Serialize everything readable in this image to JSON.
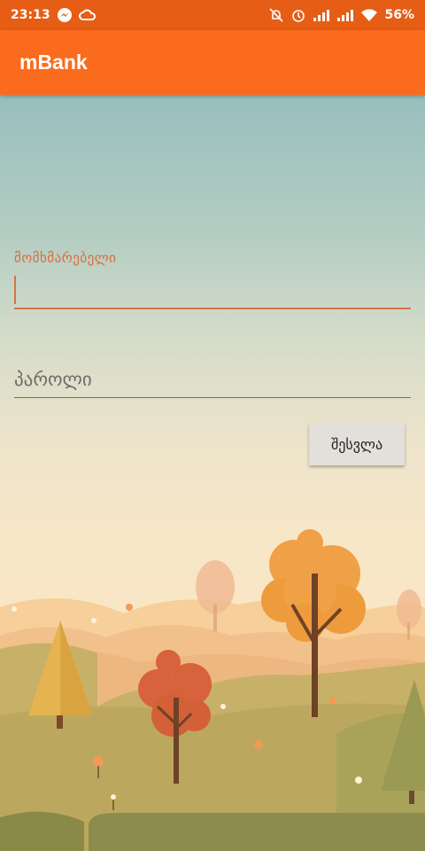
{
  "status_bar": {
    "time": "23:13",
    "battery": "56%",
    "icons": [
      "messenger-icon",
      "cloud-icon",
      "muted-notification-icon",
      "alarm-icon",
      "signal-icon",
      "signal-icon",
      "wifi-icon"
    ]
  },
  "app": {
    "title": "mBank"
  },
  "login_form": {
    "username_label": "მომხმარებელი",
    "username_value": "",
    "password_placeholder": "პაროლი",
    "submit_label": "შესვლა"
  },
  "colors": {
    "status_bar": "#e65e15",
    "app_bar": "#fb6b1d",
    "accent": "#d67446"
  }
}
